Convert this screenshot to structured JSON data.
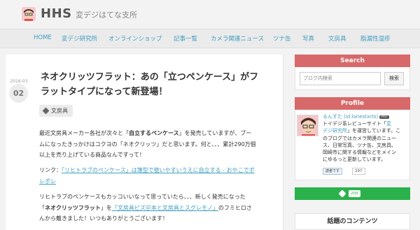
{
  "header": {
    "site_name": "HHS",
    "tagline": "変デジはてな支所"
  },
  "nav": {
    "items": [
      {
        "label": "HOME"
      },
      {
        "label": "変デジ研究所"
      },
      {
        "label": "オンラインショップ"
      },
      {
        "label": "記事一覧"
      },
      {
        "label": "カメラ関連ニュース"
      },
      {
        "label": "ツナ缶"
      },
      {
        "label": "写真"
      },
      {
        "label": "文房具"
      },
      {
        "label": "脂漏性湿疹"
      }
    ]
  },
  "article": {
    "date_ym": "2016-03",
    "date_day": "02",
    "title_line1": "ネオクリッツフラット：あの「立つペンケース」がフ",
    "title_line2": "ラットタイプになって新登場！",
    "tag": "文房具",
    "p1_l1_a": "最近文房具メーカー各社が次々と「",
    "p1_l1_b": "自立するペンケース",
    "p1_l1_c": "」を発売していますが、ブー",
    "p1_l2": "ムになったきっかけはコクヨの「ネオクリッツ」だと思います。何と、、、累計290万個",
    "p1_l3": "以上を売り上げている商品なんですって！",
    "link_prefix": "リンク：",
    "link_l1": "「リヒトラブのペンケース」は簿型で使いやすいうえに自立する - おやこでポ",
    "link_l2": "レポレ",
    "p2_l1": "リヒトラブのペンケースもカッコいいなって思っていたら、、、新しく発売になった",
    "p2_l2_a": "「",
    "p2_l2_b": "ネオクリッツフラット",
    "p2_l2_c": "」を",
    "p2_l2_link": "「文房具ピズ＠本と文房具とスグレモノ」",
    "p2_l2_d": "のフミヒロさ",
    "p2_l3": "んから戴きました！いつもありがとうございます！"
  },
  "sidebar": {
    "search_title": "Search",
    "search_placeholder": "ブログ内検索",
    "search_button": "検索",
    "profile_title": "Profile",
    "profile_name": "るんすた (id:lonestarts)",
    "profile_badge": "PRO",
    "profile_l1_a": "トイデジ系レビューサイト「",
    "profile_l1_link": "変",
    "profile_l2_link": "デジ研究所",
    "profile_l2_b": "」を運営しています。こ",
    "profile_l3": "のブログではカメラ関連のニュー",
    "profile_l4": "ス、日常写真、ツナ缶、文房具、",
    "profile_l5": "岡崎市に関する情報などをメイン",
    "profile_l6": "にゆるっと更新しています。",
    "follow_label": "読者です",
    "follow_count": "297",
    "feedly_count": "209",
    "popular_title": "話題のコンテンツ"
  },
  "colors": {
    "accent": "#3f9dbf",
    "widget_head": "#d8696a",
    "feedly": "#2bb24c"
  }
}
